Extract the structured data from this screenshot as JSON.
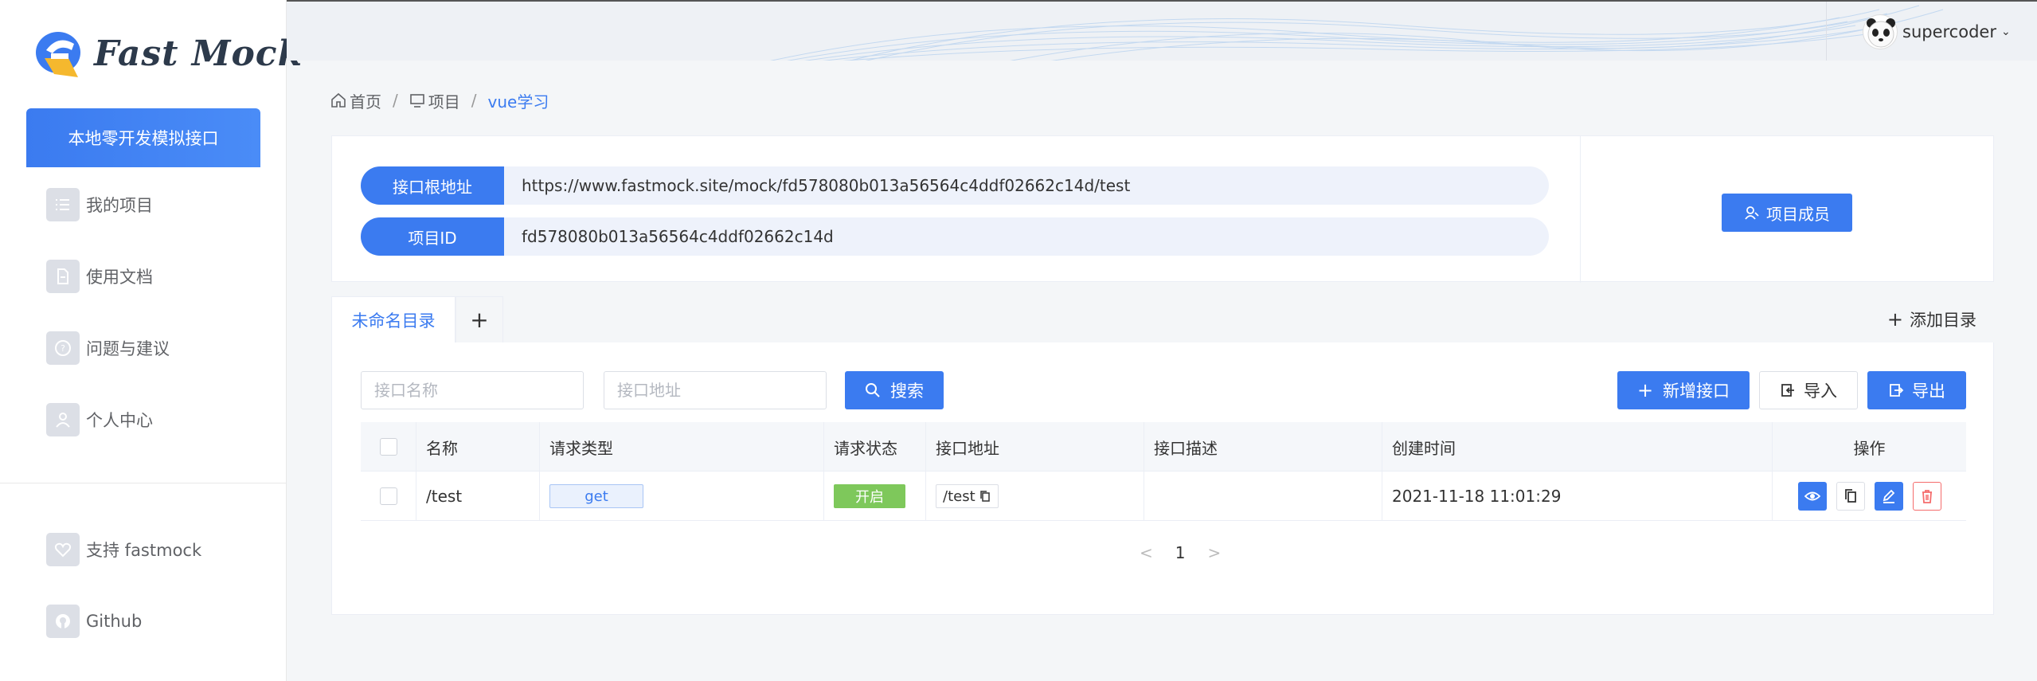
{
  "logo": {
    "text": "Fast Mock"
  },
  "sidebar": {
    "cta": "本地零开发模拟接口",
    "items": [
      {
        "label": "我的项目",
        "icon": "list-icon"
      },
      {
        "label": "使用文档",
        "icon": "document-icon"
      },
      {
        "label": "问题与建议",
        "icon": "question-icon"
      },
      {
        "label": "个人中心",
        "icon": "user-icon"
      }
    ],
    "bottom": [
      {
        "label": "支持 fastmock",
        "icon": "heart-icon"
      },
      {
        "label": "Github",
        "icon": "github-icon"
      }
    ]
  },
  "header": {
    "username": "supercoder"
  },
  "breadcrumb": {
    "home": "首页",
    "project": "项目",
    "current": "vue学习"
  },
  "project": {
    "root_label": "接口根地址",
    "root_value": "https://www.fastmock.site/mock/fd578080b013a56564c4ddf02662c14d/test",
    "id_label": "项目ID",
    "id_value": "fd578080b013a56564c4ddf02662c14d",
    "members_button": "项目成员"
  },
  "tabs": {
    "active": "未命名目录",
    "add": "+",
    "add_dir": "添加目录"
  },
  "filters": {
    "name_placeholder": "接口名称",
    "url_placeholder": "接口地址",
    "search": "搜索",
    "new_api": "新增接口",
    "import": "导入",
    "export": "导出"
  },
  "table": {
    "headers": [
      "名称",
      "请求类型",
      "请求状态",
      "接口地址",
      "接口描述",
      "创建时间",
      "操作"
    ],
    "rows": [
      {
        "name": "/test",
        "method": "get",
        "status": "开启",
        "url": "/test",
        "desc": "",
        "created": "2021-11-18 11:01:29"
      }
    ]
  },
  "pagination": {
    "prev": "<",
    "page": "1",
    "next": ">"
  },
  "colors": {
    "primary": "#3b7bf0",
    "success": "#7ec85b",
    "danger": "#f56c6c"
  }
}
